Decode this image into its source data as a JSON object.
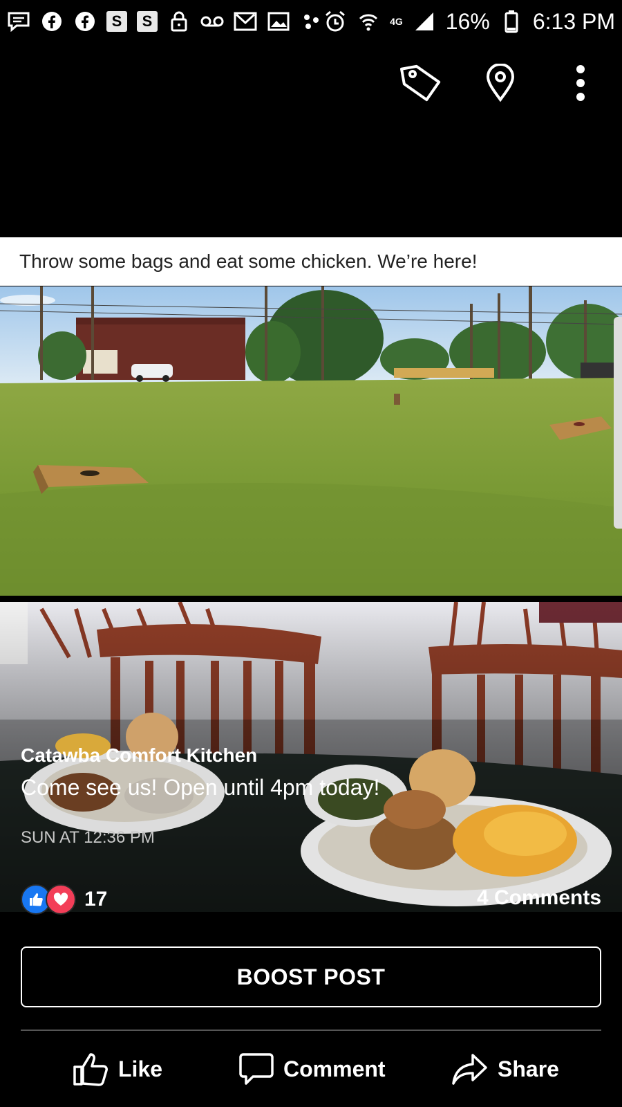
{
  "status_bar": {
    "battery": "16%",
    "time": "6:13 PM",
    "network": "4G",
    "left_icons": [
      "messages-icon",
      "facebook-icon",
      "facebook-icon",
      "s-app-icon",
      "s-app-icon",
      "lock-icon",
      "voicemail-icon",
      "gmail-icon",
      "gallery-icon",
      "dots-icon"
    ],
    "s_label": "S"
  },
  "top_bar": {
    "icons": [
      "tag-icon",
      "location-pin-icon",
      "more-vertical-icon"
    ]
  },
  "post": {
    "caption": "Throw some bags and eat some chicken. We’re here!",
    "page_name": "Catawba Comfort Kitchen",
    "text": "Come see us! Open until 4pm today!",
    "timestamp": "SUN AT 12:36 PM",
    "reaction_count": "17",
    "comments": "4 Comments"
  },
  "boost_label": "BOOST POST",
  "actions": {
    "like": "Like",
    "comment": "Comment",
    "share": "Share"
  },
  "colors": {
    "background": "#000000",
    "like_blue": "#1877f2",
    "love_red": "#f33e58",
    "grass": "#7a9a35"
  }
}
